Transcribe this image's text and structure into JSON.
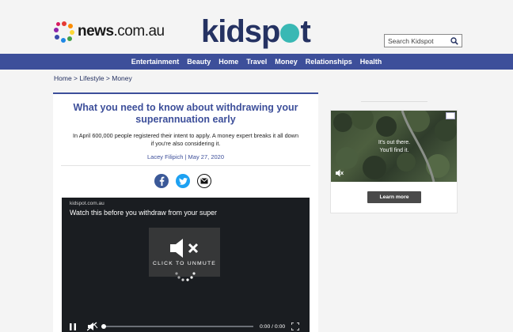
{
  "header": {
    "news_logo_bold": "news",
    "news_logo_rest": ".com.au",
    "brand_pre": "kidsp",
    "brand_post": "t",
    "search_placeholder": "Search Kidspot"
  },
  "nav": {
    "items": [
      "Entertainment",
      "Beauty",
      "Home",
      "Travel",
      "Money",
      "Relationships",
      "Health"
    ]
  },
  "breadcrumb": {
    "items": [
      "Home",
      "Lifestyle",
      "Money"
    ],
    "separator": " > "
  },
  "article": {
    "title": "What you need to know about withdrawing your superannuation early",
    "dek": "In April 600,000 people registered their intent to apply. A money expert breaks it all down if you're also considering it.",
    "byline": "Lacey Filipich | May 27, 2020",
    "share_icons": [
      "facebook-icon",
      "twitter-icon",
      "email-icon"
    ]
  },
  "video": {
    "source": "kidspot.com.au",
    "title": "Watch this before you withdraw from your super",
    "unmute_label": "CLICK TO UNMUTE",
    "time_current": "0:00",
    "time_sep": "/",
    "time_total": "0:00",
    "progress": 0
  },
  "ad": {
    "line1": "It's out there.",
    "line2": "You'll find it.",
    "cta": "Learn more"
  },
  "colors": {
    "brand_navy": "#253262",
    "nav_blue": "#3d4f9a",
    "brand_teal": "#39b8b4",
    "facebook": "#3b5998",
    "twitter": "#1da1f2"
  }
}
